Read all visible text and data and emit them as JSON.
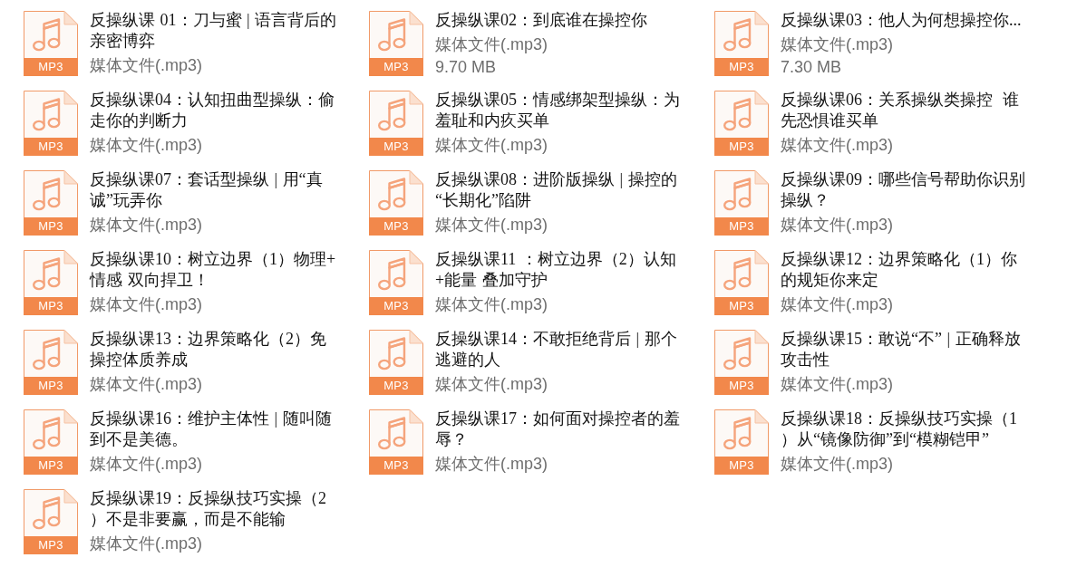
{
  "files": [
    {
      "name": "反操纵课 01：刀与蜜 | 语言背后的亲密博弈",
      "icon_label": "MP3",
      "type": "媒体文件(.mp3)"
    },
    {
      "name": "反操纵课02：到底谁在操控你",
      "icon_label": "MP3",
      "type": "媒体文件(.mp3)",
      "size": "9.70 MB"
    },
    {
      "name": "反操纵课03：他人为何想操控你...",
      "icon_label": "MP3",
      "type": "媒体文件(.mp3)",
      "size": "7.30 MB"
    },
    {
      "name": "反操纵课04：认知扭曲型操纵：偷走你的判断力",
      "icon_label": "MP3",
      "type": "媒体文件(.mp3)"
    },
    {
      "name": "反操纵课05：情感绑架型操纵：为羞耻和内疚买单",
      "icon_label": "MP3",
      "type": "媒体文件(.mp3)"
    },
    {
      "name": "反操纵课06：关系操纵类操控  谁先恐惧谁买单",
      "icon_label": "MP3",
      "type": "媒体文件(.mp3)"
    },
    {
      "name": "反操纵课07：套话型操纵 | 用“真诚”玩弄你",
      "icon_label": "MP3",
      "type": "媒体文件(.mp3)"
    },
    {
      "name": "反操纵课08：进阶版操纵 | 操控的“长期化”陷阱",
      "icon_label": "MP3",
      "type": "媒体文件(.mp3)"
    },
    {
      "name": "反操纵课09：哪些信号帮助你识别操纵？",
      "icon_label": "MP3",
      "type": "媒体文件(.mp3)"
    },
    {
      "name": "反操纵课10：树立边界（1）物理+情感 双向捍卫！",
      "icon_label": "MP3",
      "type": "媒体文件(.mp3)"
    },
    {
      "name": "反操纵课11 ：树立边界（2）认知+能量 叠加守护",
      "icon_label": "MP3",
      "type": "媒体文件(.mp3)"
    },
    {
      "name": "反操纵课12：边界策略化（1）你的规矩你来定",
      "icon_label": "MP3",
      "type": "媒体文件(.mp3)"
    },
    {
      "name": "反操纵课13：边界策略化（2）免操控体质养成",
      "icon_label": "MP3",
      "type": "媒体文件(.mp3)"
    },
    {
      "name": "反操纵课14：不敢拒绝背后 | 那个逃避的人",
      "icon_label": "MP3",
      "type": "媒体文件(.mp3)"
    },
    {
      "name": "反操纵课15：敢说“不” | 正确释放攻击性",
      "icon_label": "MP3",
      "type": "媒体文件(.mp3)"
    },
    {
      "name": "反操纵课16：维护主体性 | 随叫随到不是美德。",
      "icon_label": "MP3",
      "type": "媒体文件(.mp3)"
    },
    {
      "name": "反操纵课17：如何面对操控者的羞辱？",
      "icon_label": "MP3",
      "type": "媒体文件(.mp3)"
    },
    {
      "name": "反操纵课18：反操纵技巧实操（1）从“镜像防御”到“模糊铠甲”",
      "icon_label": "MP3",
      "type": "媒体文件(.mp3)"
    },
    {
      "name": "反操纵课19：反操纵技巧实操（2）不是非要赢，而是不能输",
      "icon_label": "MP3",
      "type": "媒体文件(.mp3)"
    }
  ]
}
